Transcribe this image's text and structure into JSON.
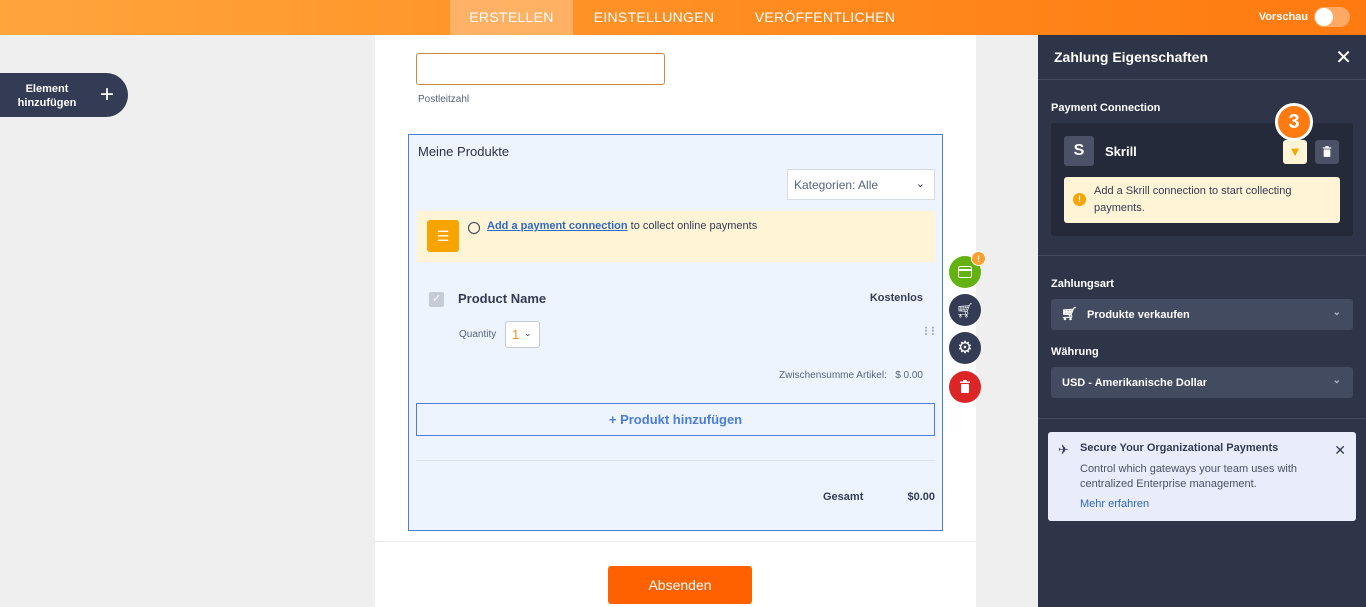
{
  "topbar": {
    "tabs": [
      {
        "label": "ERSTELLEN",
        "active": true
      },
      {
        "label": "EINSTELLUNGEN",
        "active": false
      },
      {
        "label": "VERÖFFENTLICHEN",
        "active": false
      }
    ],
    "preview_label": "Vorschau",
    "preview_on": false
  },
  "left": {
    "add_element_label": "Element hinzufügen"
  },
  "form": {
    "zip_label": "Postleitzahl",
    "zip_value": "",
    "products": {
      "title": "Meine Produkte",
      "category_select": "Kategorien: Alle",
      "notice_link": "Add a payment connection",
      "notice_text": " to collect online payments",
      "product_name": "Product Name",
      "product_price": "Kostenlos",
      "quantity_label": "Quantity",
      "quantity_value": "1",
      "subtotal_label": "Zwischensumme Artikel:",
      "subtotal_value": "$ 0.00",
      "add_product_label": "+ Produkt hinzufügen",
      "total_label": "Gesamt",
      "total_value": "$0.00"
    },
    "submit_label": "Absenden"
  },
  "toolbar": {
    "badge": "!",
    "icons": [
      "payment-card-icon",
      "cart-icon",
      "gear-icon",
      "trash-icon"
    ]
  },
  "panel": {
    "title": "Zahlung Eigenschaften",
    "payment_connection_label": "Payment Connection",
    "gateway_letter": "S",
    "gateway_name": "Skrill",
    "step_number": "3",
    "warning_text": "Add a Skrill connection to start collecting payments.",
    "payment_type_label": "Zahlungsart",
    "payment_type_value": "Produkte verkaufen",
    "currency_label": "Währung",
    "currency_value": "USD - Amerikanische Dollar",
    "enterprise": {
      "title": "Secure Your Organizational Payments",
      "desc": "Control which gateways your team uses with centralized Enterprise management.",
      "link": "Mehr erfahren"
    }
  },
  "colors": {
    "accent_orange": "#ff8a1e",
    "panel_bg": "#2f3548",
    "link_blue": "#2e69c6",
    "submit": "#ff6100"
  }
}
